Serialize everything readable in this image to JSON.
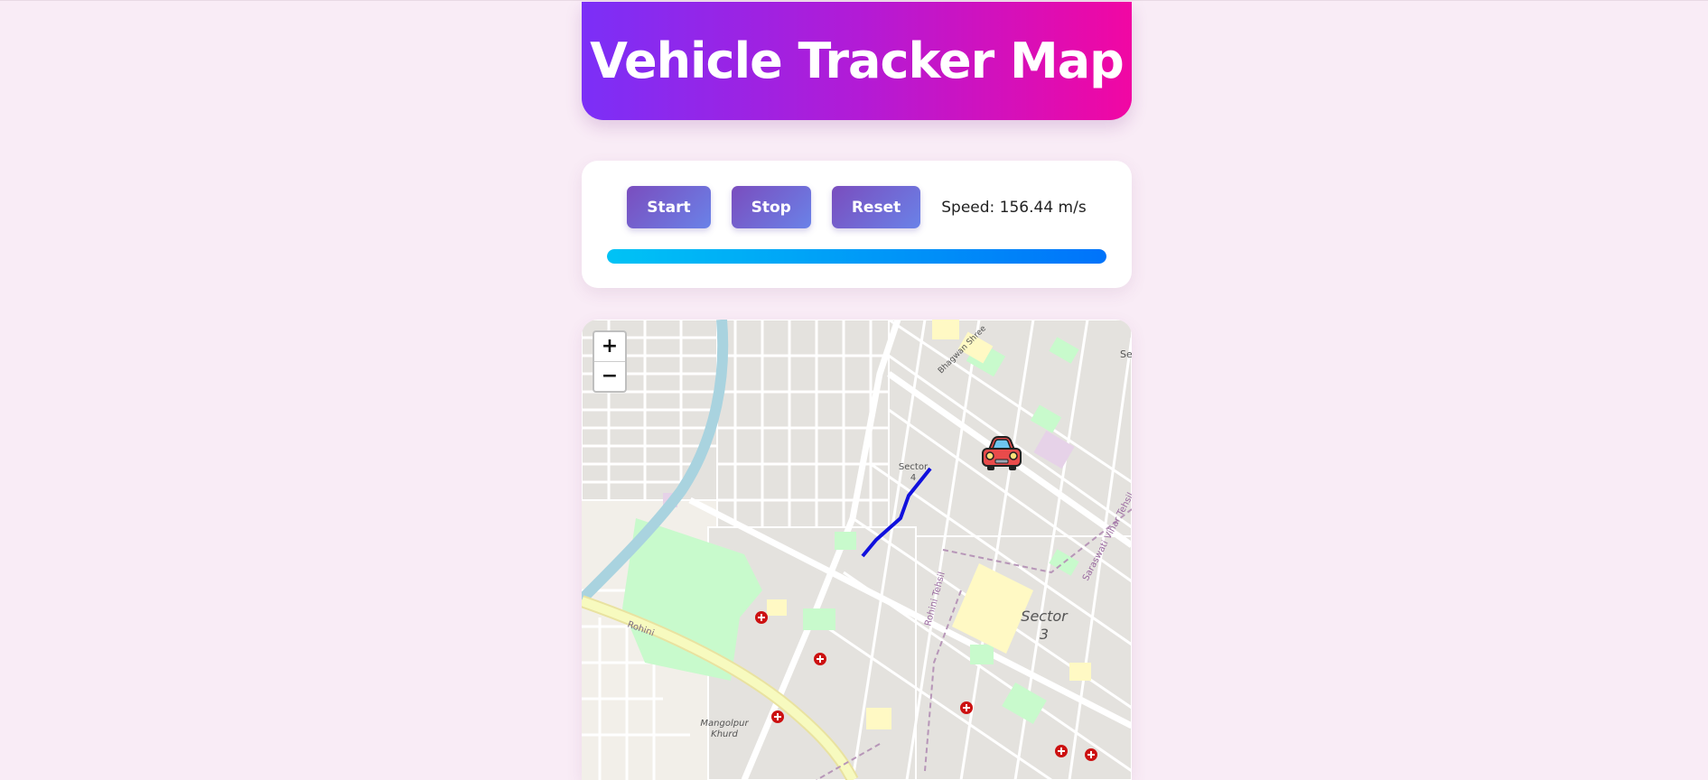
{
  "header": {
    "title": "Vehicle Tracker Map"
  },
  "controls": {
    "start_label": "Start",
    "stop_label": "Stop",
    "reset_label": "Reset",
    "speed_text": "Speed: 156.44 m/s",
    "progress_percent": 100
  },
  "map": {
    "zoom_in_label": "+",
    "zoom_out_label": "−",
    "labels": {
      "sector4": [
        "Sector",
        "4"
      ],
      "sector3": [
        "Sector",
        "3"
      ],
      "sec_edge": "Sec",
      "bhagwan": "Bhagwan Shree",
      "rohini": "Rohini",
      "rohini_tehsil": "Rohini Tehsil",
      "saraswati": "Saraswati Vihar Tehsil",
      "mangolpur": [
        "Mangolpur",
        "Khurd"
      ]
    },
    "colors": {
      "route": "#1010dd",
      "canal": "#a9d3df",
      "park": "#c8facc",
      "hospital": "#cc1111",
      "main_road": "#f7fabf"
    },
    "icons": [
      "car-icon",
      "hospital-marker-icon"
    ]
  }
}
